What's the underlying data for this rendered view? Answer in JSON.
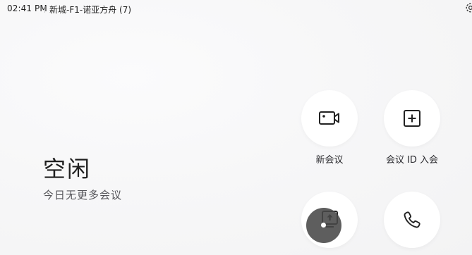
{
  "status_bar": {
    "time": "02:41 PM",
    "room_name": "新城-F1-诺亚方舟 (7)",
    "settings_icon": "gear-icon"
  },
  "idle": {
    "title": "空闲",
    "subtitle": "今日无更多会议"
  },
  "actions": [
    {
      "label": "新会议",
      "icon": "video-camera-icon"
    },
    {
      "label": "会议 ID 入会",
      "icon": "plus-square-icon"
    },
    {
      "label": "",
      "icon": "share-screen-icon"
    },
    {
      "label": "",
      "icon": "phone-icon"
    }
  ],
  "colors": {
    "background": "#f6f6f7",
    "button": "#ffffff",
    "text": "#1f1f1f",
    "touch_indicator": "#484848"
  }
}
